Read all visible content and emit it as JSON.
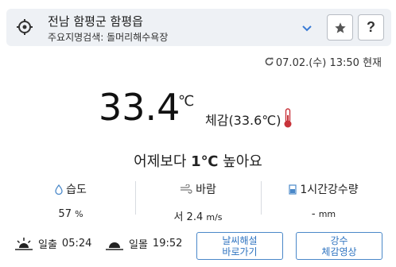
{
  "location": {
    "name": "전남 함평군 함평읍",
    "sub": "주요지명검색: 돌머리해수욕장",
    "help_label": "?"
  },
  "observed": {
    "datetime": "07.02.(수) 13:50 현재"
  },
  "current": {
    "temperature": "33.4",
    "unit": "℃",
    "feels_like": "체감(33.6℃)",
    "compare_prefix": "어제보다 ",
    "compare_value": "1℃",
    "compare_suffix": " 높아요"
  },
  "stats": {
    "humidity": {
      "label": "습도",
      "value": "57",
      "unit": "%"
    },
    "wind": {
      "label": "바람",
      "value": "서 2.4",
      "unit": "m/s"
    },
    "rain": {
      "label": "1시간강수량",
      "value": "-",
      "unit": "mm"
    }
  },
  "sun": {
    "sunrise_label": "일출",
    "sunrise_time": "05:24",
    "sunset_label": "일몰",
    "sunset_time": "19:52"
  },
  "buttons": {
    "tide": "날씨해설\n바로가기",
    "rain_video": "강수\n체감영상"
  },
  "colors": {
    "accent": "#2e73c0",
    "bar_bg": "#eef1f5",
    "thermo_red": "#c8333a"
  }
}
